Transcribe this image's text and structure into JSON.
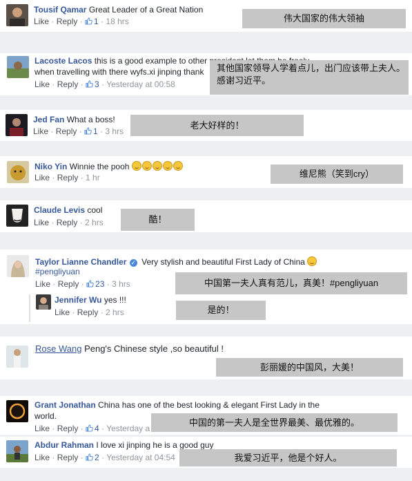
{
  "comments": [
    {
      "name": "Tousif Qamar",
      "text": "Great Leader of a Great Nation",
      "like": "Like",
      "reply": "Reply",
      "likes": "1",
      "time": "18 hrs",
      "translation": "伟大国家的伟大领袖"
    },
    {
      "name": "Lacoste Lacos",
      "text": "this is a good example to other president let them be freely",
      "text2": "when travelling with there wyfs.xi jinping thank",
      "like": "Like",
      "reply": "Reply",
      "likes": "3",
      "time": "Yesterday at 00:58",
      "translation": "其他国家领导人学着点儿，出门应该带上夫人。",
      "translation2": "感谢习近平。"
    },
    {
      "name": "Jed Fan",
      "text": "What a boss!",
      "like": "Like",
      "reply": "Reply",
      "likes": "1",
      "time": "3 hrs",
      "translation": "老大好样的！"
    },
    {
      "name": "Niko Yin",
      "text": "Winnie the pooh",
      "like": "Like",
      "reply": "Reply",
      "time": "1 hr",
      "translation": "维尼熊（笑到cry）"
    },
    {
      "name": "Claude Levis",
      "text": "cool",
      "like": "Like",
      "reply": "Reply",
      "time": "2 hrs",
      "translation": "酷！"
    },
    {
      "name": "Taylor Lianne Chandler",
      "text": "Very stylish and beautiful First Lady of China",
      "hashtag": "#pengliyuan",
      "like": "Like",
      "reply": "Reply",
      "likes": "23",
      "time": "3 hrs",
      "translation": "中国第一夫人真有范儿，真美！#pengliyuan"
    },
    {
      "name": "Jennifer Wu",
      "text": "yes !!!",
      "like": "Like",
      "reply": "Reply",
      "time": "2 hrs",
      "translation": "是的！"
    },
    {
      "name": "Rose Wang",
      "text": "Peng's Chinese style ,so beautiful !",
      "translation": "彭丽媛的中国风，大美！"
    },
    {
      "name": "Grant Jonathan",
      "text": "China has one of the best looking & elegant First Lady in the",
      "text2": "world.",
      "like": "Like",
      "reply": "Reply",
      "likes": "4",
      "time": "Yesterday a",
      "translation": "中国的第一夫人是全世界最美、最优雅的。"
    },
    {
      "name": "Abdur Rahman",
      "text": "I love xi jinping he is a good guy",
      "like": "Like",
      "reply": "Reply",
      "likes": "2",
      "time": "Yesterday at 04:54",
      "translation": "我爱习近平，他是个好人。"
    }
  ],
  "colors": {
    "name": "#365899",
    "meta": "#90949c",
    "overlay": "#c6c6c6",
    "page": "#eeeff2"
  },
  "icons": [
    "thumbs-up-icon",
    "verified-badge-icon",
    "grinning-emoji-icon",
    "avatar-photo"
  ]
}
